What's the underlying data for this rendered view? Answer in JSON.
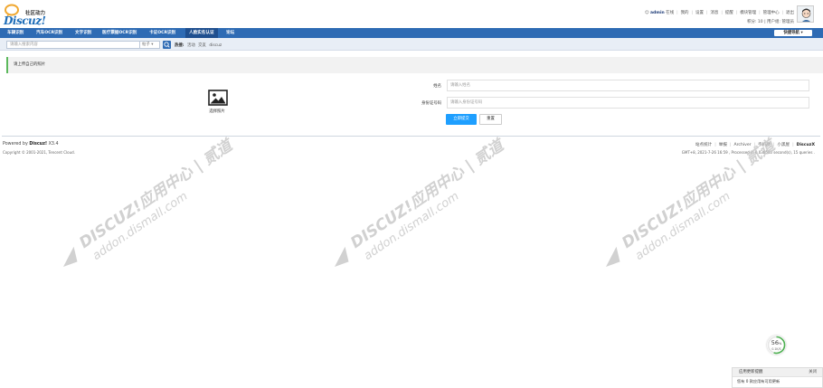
{
  "header": {
    "logo_community": "社区动力",
    "logo_text": "Discuz!",
    "user_links": [
      "admin",
      "在线",
      "我的",
      "设置",
      "消息",
      "提醒",
      "模块管理",
      "管理中心",
      "退出"
    ],
    "user_links2": [
      "积分: 10",
      "用户组: 管理员"
    ]
  },
  "nav": {
    "items": [
      "车辆识别",
      "汽车OCR识别",
      "文字识别",
      "医疗票据OCR识别",
      "卡证OCR识别",
      "人脸实名认证",
      "论坛"
    ],
    "active_index": 5,
    "quick_nav": "快捷导航"
  },
  "search": {
    "placeholder": "请输入搜索内容",
    "scope": "帖子",
    "hot_label": "热搜:",
    "hot_terms": [
      "活动",
      "交友",
      "discuz"
    ]
  },
  "notice": {
    "text": "请上传自己的照片"
  },
  "form": {
    "photo_label": "选择照片",
    "name_label": "姓名",
    "name_placeholder": "请输入姓名",
    "id_label": "身份证号码",
    "id_placeholder": "请输入身份证号码",
    "submit_label": "立即提交",
    "reset_label": "重置"
  },
  "footer": {
    "powered_prefix": "Powered by",
    "powered_brand": "Discuz!",
    "powered_version": "X3.4",
    "copyright": "Copyright © 2001-2021, Tencent Cloud.",
    "links": [
      "站点统计",
      "举报",
      "Archiver",
      "手机版",
      "小黑屋"
    ],
    "brand": "DiscuzX",
    "stats": "GMT+8, 2021-7-26 16:59 , Processed in 0.038585 second(s), 15 queries ."
  },
  "watermark": {
    "line1": "DISCUZ!应用中心 | 贰道",
    "line2": "addon.dismall.com"
  },
  "speed": {
    "value": "56",
    "unit": "%",
    "label": "0.1K/S"
  },
  "update_panel": {
    "title": "应用更新提醒",
    "close": "关闭",
    "body": "您有 0 款应用有可用更新"
  },
  "colors": {
    "nav_bg": "#2e6bb4",
    "nav_active": "#1f4f8f",
    "submit_bg": "#1e9fff",
    "notice_accent": "#5cb85c"
  }
}
